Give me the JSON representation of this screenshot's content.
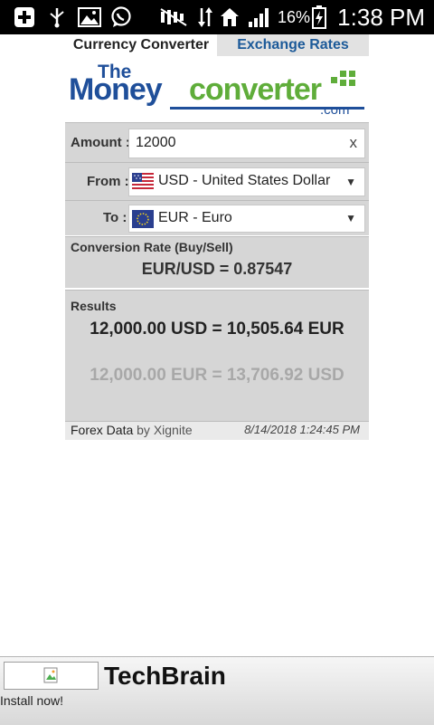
{
  "status_bar": {
    "battery_percent": "16%",
    "time": "1:38 PM",
    "icons": [
      "add-icon",
      "usb-icon",
      "image-icon",
      "whatsapp-icon",
      "mute-icon",
      "data-transfer-icon",
      "home-icon",
      "signal-icon",
      "battery-icon"
    ]
  },
  "tabs": [
    {
      "label": "Currency Converter",
      "active": true
    },
    {
      "label": "Exchange Rates",
      "active": false
    }
  ],
  "logo": {
    "the": "The",
    "money": "Money",
    "converter": "converter",
    "dotcom": ".com"
  },
  "amount": {
    "label": "Amount :",
    "value": "12000",
    "clear": "x"
  },
  "from": {
    "label": "From :",
    "value": "USD - United States Dollar",
    "flag": "us-flag-icon"
  },
  "to": {
    "label": "To :",
    "value": "EUR - Euro",
    "flag": "eu-flag-icon"
  },
  "rate": {
    "title": "Conversion Rate (Buy/Sell)",
    "value": "EUR/USD = 0.87547"
  },
  "results": {
    "title": "Results",
    "primary": "12,000.00 USD = 10,505.64 EUR",
    "secondary": "12,000.00 EUR = 13,706.92 USD"
  },
  "footer": {
    "forex": "Forex Data",
    "by": "by Xignite",
    "timestamp": "8/14/2018 1:24:45 PM"
  },
  "ad": {
    "name": "TechBrain",
    "install": "Install now!"
  },
  "colors": {
    "blue": "#1f4f9a",
    "green": "#5fad3a",
    "result_secondary": "#a8a8a8"
  }
}
